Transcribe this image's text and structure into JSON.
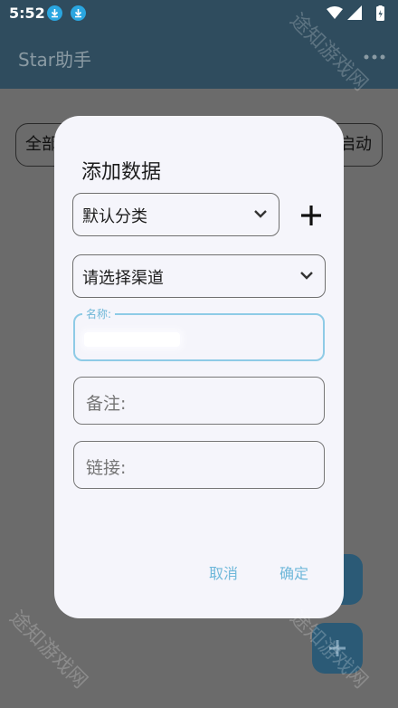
{
  "status_bar": {
    "time": "5:52",
    "icons": [
      "download-icon",
      "download-icon",
      "wifi-icon",
      "signal-icon",
      "battery-icon"
    ]
  },
  "app_bar": {
    "title": "Star助手",
    "menu_icon": "more-vert-icon"
  },
  "background": {
    "filter_left_label": "全部",
    "filter_right_label": "启动",
    "fab_icon": "add-icon"
  },
  "dialog": {
    "title": "添加数据",
    "category_dropdown": {
      "value": "默认分类"
    },
    "add_category_icon": "plus-icon",
    "channel_dropdown": {
      "value": "请选择渠道"
    },
    "name_field": {
      "label": "名称:",
      "value": ""
    },
    "remark_field": {
      "placeholder": "备注:"
    },
    "link_field": {
      "placeholder": "链接:"
    },
    "actions": {
      "cancel": "取消",
      "confirm": "确定"
    }
  },
  "watermark": "途知游戏网",
  "colors": {
    "app_bar": "#2f4c5e",
    "scrim": "#6b6b6b",
    "dialog_bg": "#f5f5fb",
    "accent": "#6fb8da",
    "focus_border": "#8ecbe6"
  }
}
